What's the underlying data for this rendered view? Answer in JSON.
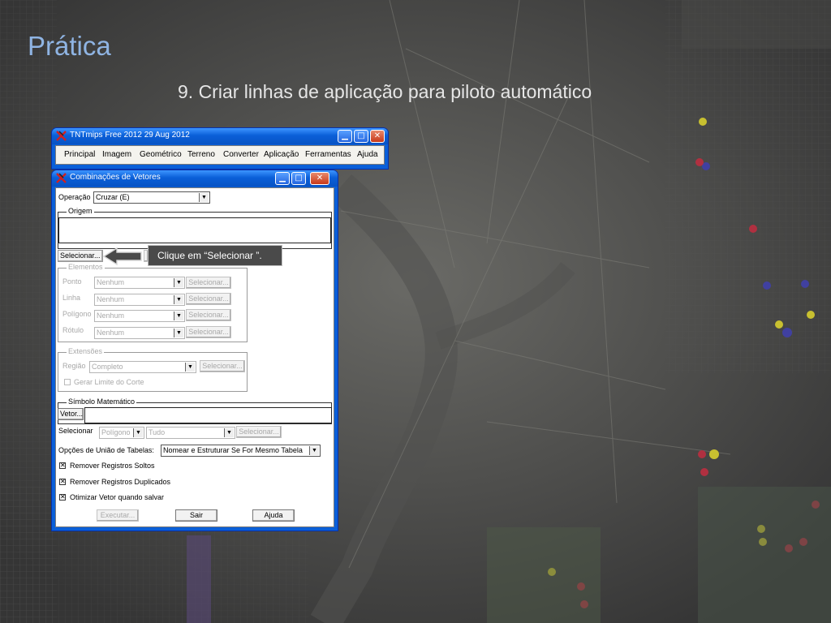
{
  "slide": {
    "title": "Prática",
    "subtitle": "9. Criar linhas de aplicação para piloto automático"
  },
  "main_window": {
    "title": "TNTmips Free 2012   29 Aug 2012",
    "icon": "tntmips-icon",
    "menu": [
      "Principal",
      "Imagem",
      "Geométrico",
      "Terreno",
      "Converter",
      "Aplicação",
      "Ferramentas",
      "Ajuda"
    ]
  },
  "dialog": {
    "title": "Combinações de Vetores",
    "operation_label": "Operação",
    "operation_value": "Cruzar (E)",
    "origin_label": "Origem",
    "origin_select_button": "Selecionar...",
    "elements_label": "Elementos",
    "elements": [
      {
        "label": "Ponto",
        "value": "Nenhum",
        "button": "Selecionar..."
      },
      {
        "label": "Linha",
        "value": "Nenhum",
        "button": "Selecionar..."
      },
      {
        "label": "Polígono",
        "value": "Nenhum",
        "button": "Selecionar..."
      },
      {
        "label": "Rótulo",
        "value": "Nenhum",
        "button": "Selecionar..."
      }
    ],
    "extents_label": "Extensões",
    "region_label": "Região",
    "region_value": "Completo",
    "region_button": "Selecionar...",
    "clip_limit_label": "Gerar Limite do Corte",
    "math_symbol_label": "Símbolo Matemático",
    "vector_button": "Vetor...",
    "select_label": "Selecionar",
    "select_type_value": "Polígono",
    "select_scope_value": "Tudo",
    "select_button": "Selecionar...",
    "table_join_label": "Opções de União de Tabelas:",
    "table_join_value": "Nomear e Estruturar Se For Mesmo Tabela",
    "checkboxes": [
      {
        "label": "Remover Registros Soltos",
        "checked": true
      },
      {
        "label": "Remover Registros Duplicados",
        "checked": true
      },
      {
        "label": "Otimizar Vetor quando salvar",
        "checked": true
      }
    ],
    "execute_button": "Executar...",
    "exit_button": "Sair",
    "help_button": "Ajuda"
  },
  "callout": {
    "text": "Clique em “Selecionar ”."
  },
  "colors": {
    "title_accent": "#8fb4e3",
    "xp_titlebar": "#0a5fd8",
    "callout_bg": "#4a4a4a"
  }
}
